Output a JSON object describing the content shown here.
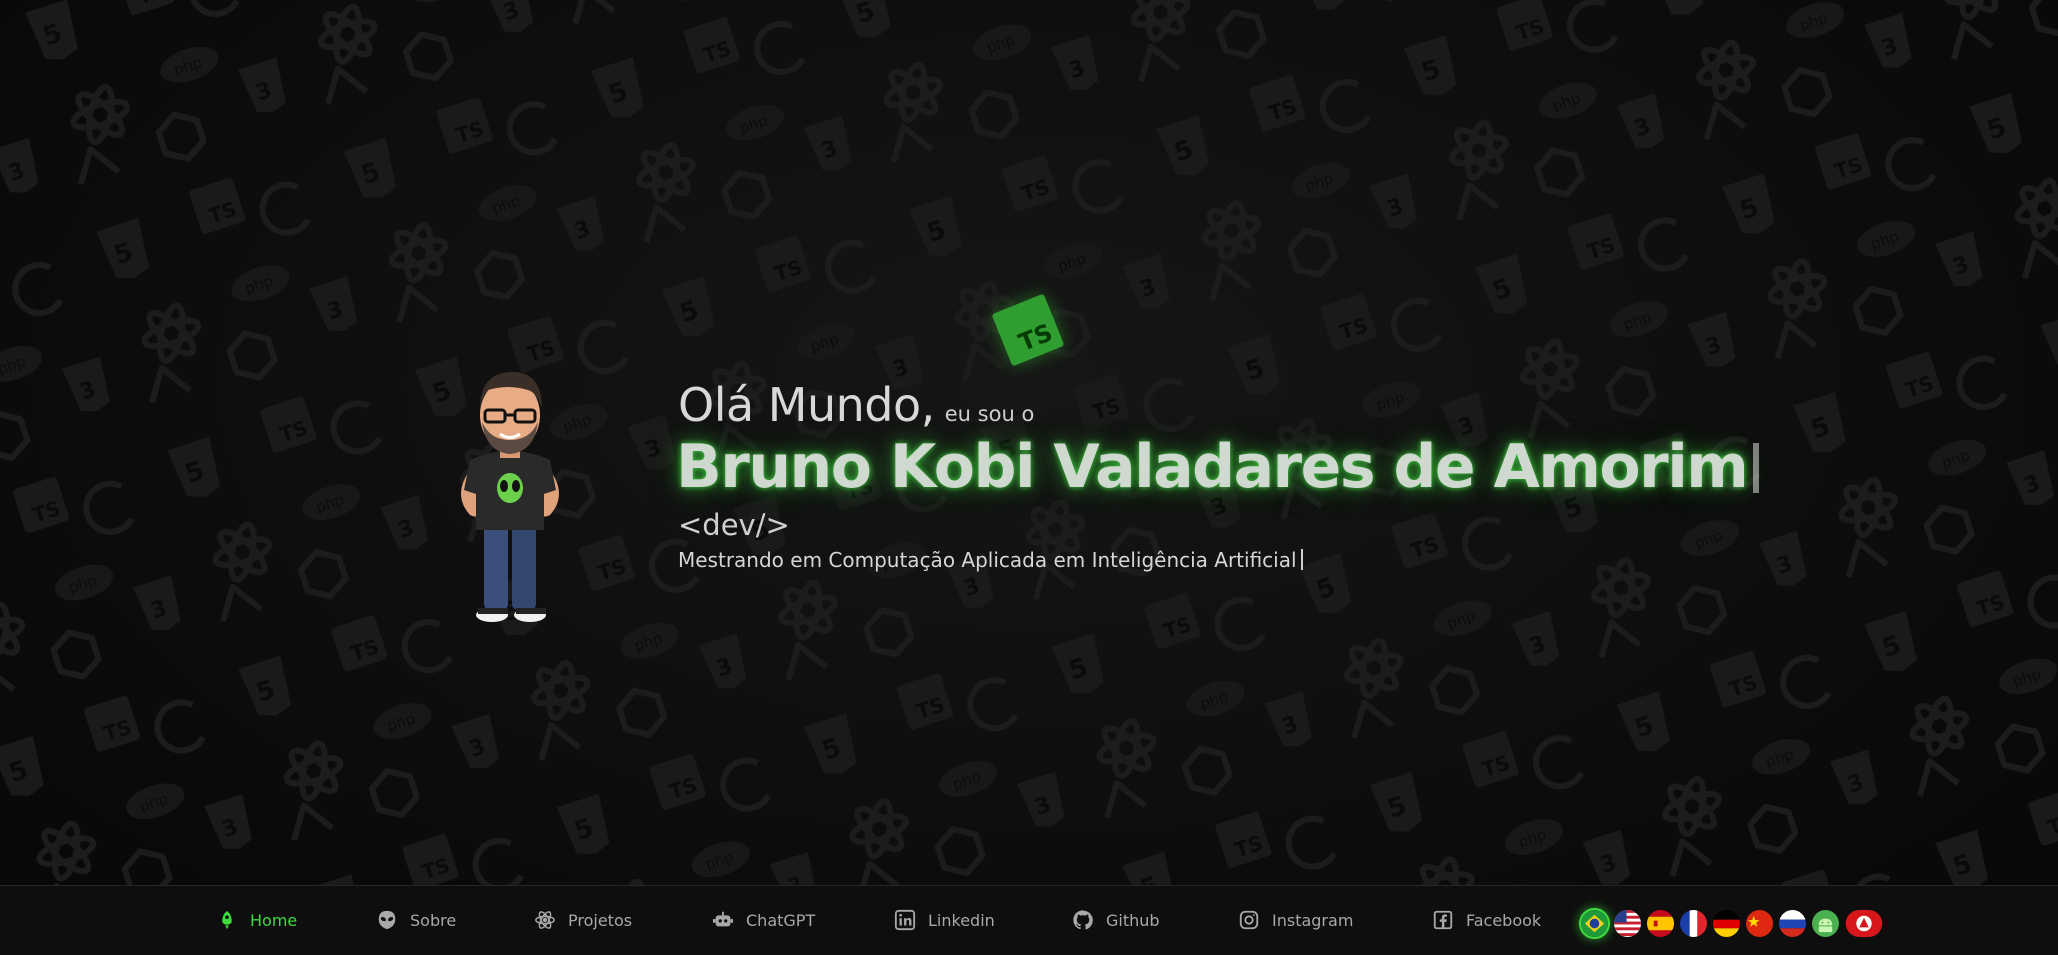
{
  "hero": {
    "greeting": "Olá Mundo,",
    "intro": "eu sou o",
    "name": "Bruno Kobi Valadares de Amorim",
    "dev_tag": "<dev/>",
    "subtitle": "Mestrando em Computação Aplicada em Inteligência Artificial",
    "badge_text": "TS"
  },
  "nav": {
    "items": [
      {
        "label": "Home",
        "icon": "rocket-icon",
        "active": true
      },
      {
        "label": "Sobre",
        "icon": "alien-icon"
      },
      {
        "label": "Projetos",
        "icon": "atom-icon"
      },
      {
        "label": "ChatGPT",
        "icon": "robot-icon"
      },
      {
        "label": "Linkedin",
        "icon": "linkedin-icon"
      },
      {
        "label": "Github",
        "icon": "github-icon"
      },
      {
        "label": "Instagram",
        "icon": "instagram-icon"
      },
      {
        "label": "Facebook",
        "icon": "facebook-icon"
      }
    ],
    "languages": [
      {
        "icon": "brazil-flag-icon",
        "active": true
      },
      {
        "icon": "usa-flag-icon"
      },
      {
        "icon": "spain-flag-icon"
      },
      {
        "icon": "france-flag-icon"
      },
      {
        "icon": "germany-flag-icon"
      },
      {
        "icon": "china-flag-icon"
      },
      {
        "icon": "russia-flag-icon"
      },
      {
        "icon": "android-language-icon"
      },
      {
        "icon": "portfolio-logo-icon"
      }
    ]
  },
  "colors": {
    "accent": "#3fdc3f",
    "background": "#0b0b0b",
    "text": "#d6d6d6"
  }
}
